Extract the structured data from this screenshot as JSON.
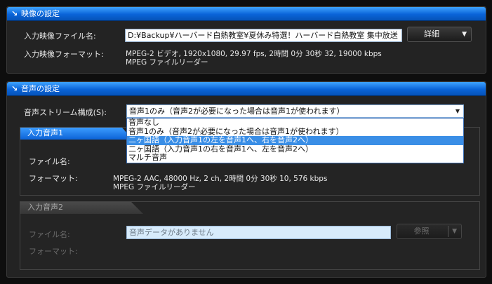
{
  "video_section": {
    "header": "映像の設定",
    "input_file_label": "入力映像ファイル名:",
    "input_file_value": "D:¥Backup¥ハーバード白熱教室¥夏休み特選！ハーバード白熱教室 集中放送",
    "details_button": "詳細",
    "format_label": "入力映像フォーマット:",
    "format_line1": "MPEG-2 ビデオ, 1920x1080, 29.97 fps, 2時間 0分 30秒 32, 19000 kbps",
    "format_line2": "MPEG ファイルリーダー"
  },
  "audio_section": {
    "header": "音声の設定",
    "stream_label": "音声ストリーム構成(S):",
    "stream_selected": "音声1のみ（音声2が必要になった場合は音声1が使われます）",
    "stream_options": [
      "音声なし",
      "音声1のみ（音声2が必要になった場合は音声1が使われます）",
      "二ヶ国語（入力音声1の左を音声1へ、右を音声2へ）",
      "二ヶ国語（入力音声1の右を音声1へ、左を音声2へ）",
      "マルチ音声"
    ],
    "highlighted_option_index": 2,
    "input1": {
      "tab": "入力音声1",
      "file_label": "ファイル名:",
      "format_label": "フォーマット:",
      "format_line1": "MPEG-2 AAC, 48000 Hz, 2 ch, 2時間 0分 30秒 10, 576 kbps",
      "format_line2": "MPEG ファイルリーダー"
    },
    "input2": {
      "tab": "入力音声2",
      "file_label": "ファイル名:",
      "file_value": "音声データがありません",
      "browse_button": "参照",
      "format_label": "フォーマット:"
    }
  },
  "colors": {
    "header_blue": "#0a64d8",
    "selection_blue": "#3a8ee6",
    "background": "#0e0e0e"
  }
}
